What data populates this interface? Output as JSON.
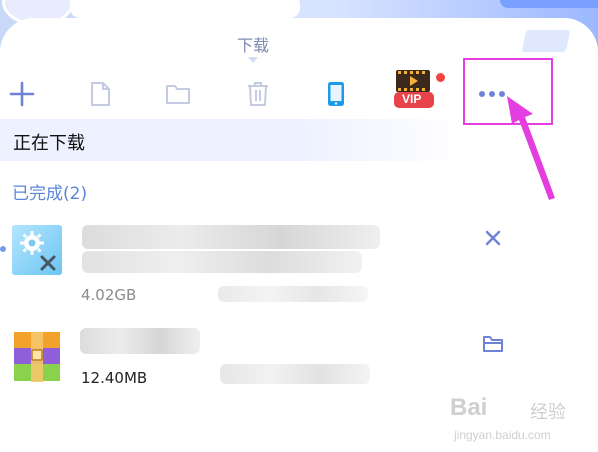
{
  "header": {
    "tab_label": "下载"
  },
  "toolbar": {
    "vip_label": "VIP",
    "items": [
      {
        "name": "add",
        "icon": "plus-icon"
      },
      {
        "name": "new-file",
        "icon": "file-icon"
      },
      {
        "name": "open-folder",
        "icon": "folder-icon"
      },
      {
        "name": "delete",
        "icon": "trash-icon"
      },
      {
        "name": "phone",
        "icon": "phone-icon"
      },
      {
        "name": "vip",
        "icon": "vip-film-icon"
      },
      {
        "name": "more",
        "icon": "more-dots-icon"
      }
    ]
  },
  "tabs": {
    "downloading": "正在下载"
  },
  "completed": {
    "title": "已完成(2)",
    "items": [
      {
        "size": "4.02GB",
        "action_icon": "close-icon",
        "file_icon": "settings-exe-icon"
      },
      {
        "size": "12.40MB",
        "action_icon": "folder-icon",
        "file_icon": "archive-icon"
      }
    ]
  },
  "watermark": {
    "logo": "Bai",
    "cn": "经验",
    "url": "jingyan.baidu.com"
  },
  "colors": {
    "accent": "#6f83d6",
    "section_title": "#5b86d8",
    "annotation": "#e43ee0",
    "vip_red": "#e8424a"
  }
}
